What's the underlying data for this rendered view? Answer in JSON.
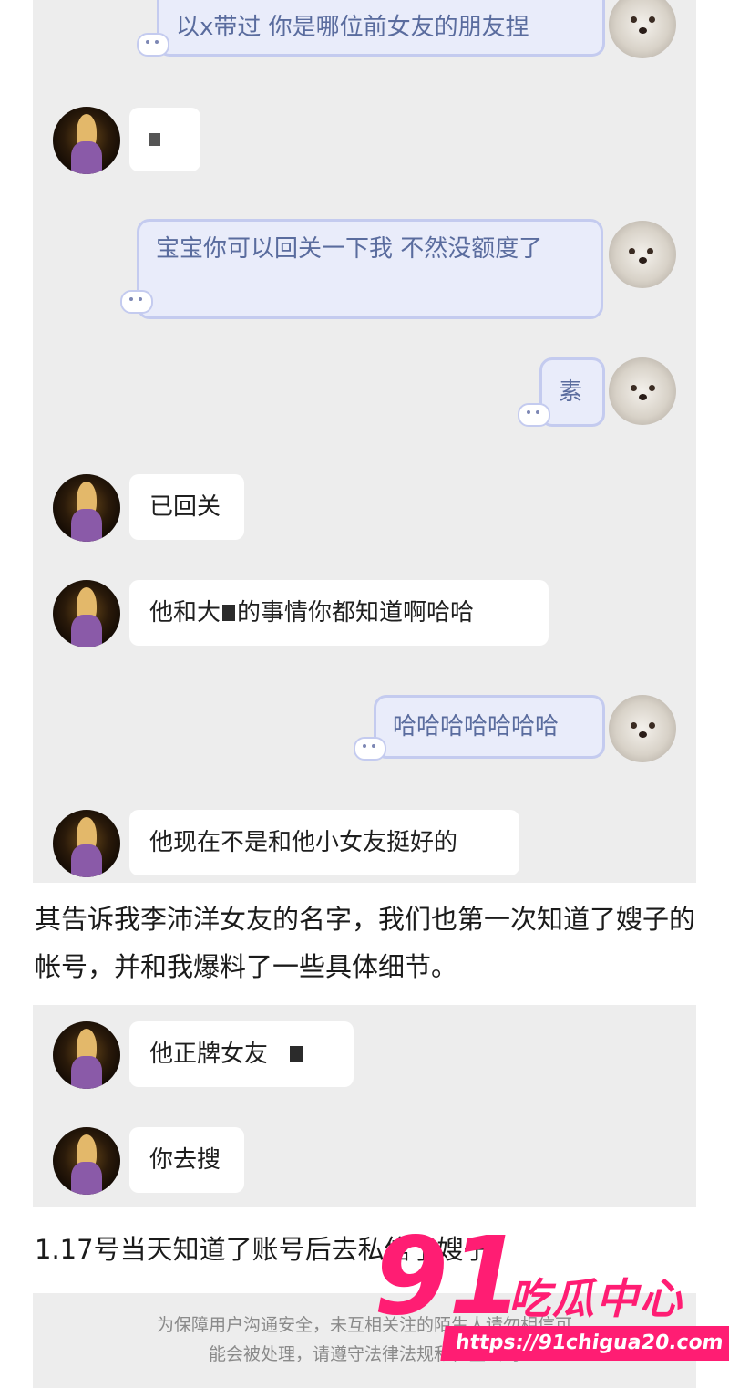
{
  "chat_block_1": {
    "messages": [
      {
        "side": "out",
        "text": "以x带过 你是哪位前女友的朋友捏"
      },
      {
        "side": "in",
        "text": ""
      },
      {
        "side": "out",
        "text": "宝宝你可以回关一下我 不然没额度了"
      },
      {
        "side": "out",
        "text": "素"
      },
      {
        "side": "in",
        "text": "已回关"
      },
      {
        "side": "in",
        "text_before": "他和大",
        "text_after": "的事情你都知道啊哈哈"
      },
      {
        "side": "out",
        "text": "哈哈哈哈哈哈哈"
      },
      {
        "side": "in",
        "text": "他现在不是和他小女友挺好的"
      }
    ]
  },
  "caption_1": "其告诉我李沛洋女友的名字，我们也第一次知道了嫂子的帐号，并和我爆料了一些具体细节。",
  "chat_block_2": {
    "messages": [
      {
        "side": "in",
        "text": "他正牌女友"
      },
      {
        "side": "in",
        "text": "你去搜"
      }
    ]
  },
  "caption_2": "1.17号当天知道了账号后去私信了嫂子",
  "notice": {
    "line1": "为保障用户沟通安全，未互相关注的陌生人请勿相信可",
    "line2": "能会被处理，请遵守法律法规和社区公约"
  },
  "watermark": {
    "number": "91",
    "name": "吃瓜中心",
    "url": "https://91chigua20.com"
  },
  "colors": {
    "panel_bg": "#ededed",
    "out_bubble_bg": "#e9ecfa",
    "out_bubble_border": "#c4cbef",
    "out_text": "#5a6c9e",
    "watermark": "#ff1d73"
  },
  "icons": {
    "girl_avatar": "girl-avatar-icon",
    "dog_avatar": "dog-avatar-icon",
    "bubble_deco": "cloud-deco-icon"
  }
}
